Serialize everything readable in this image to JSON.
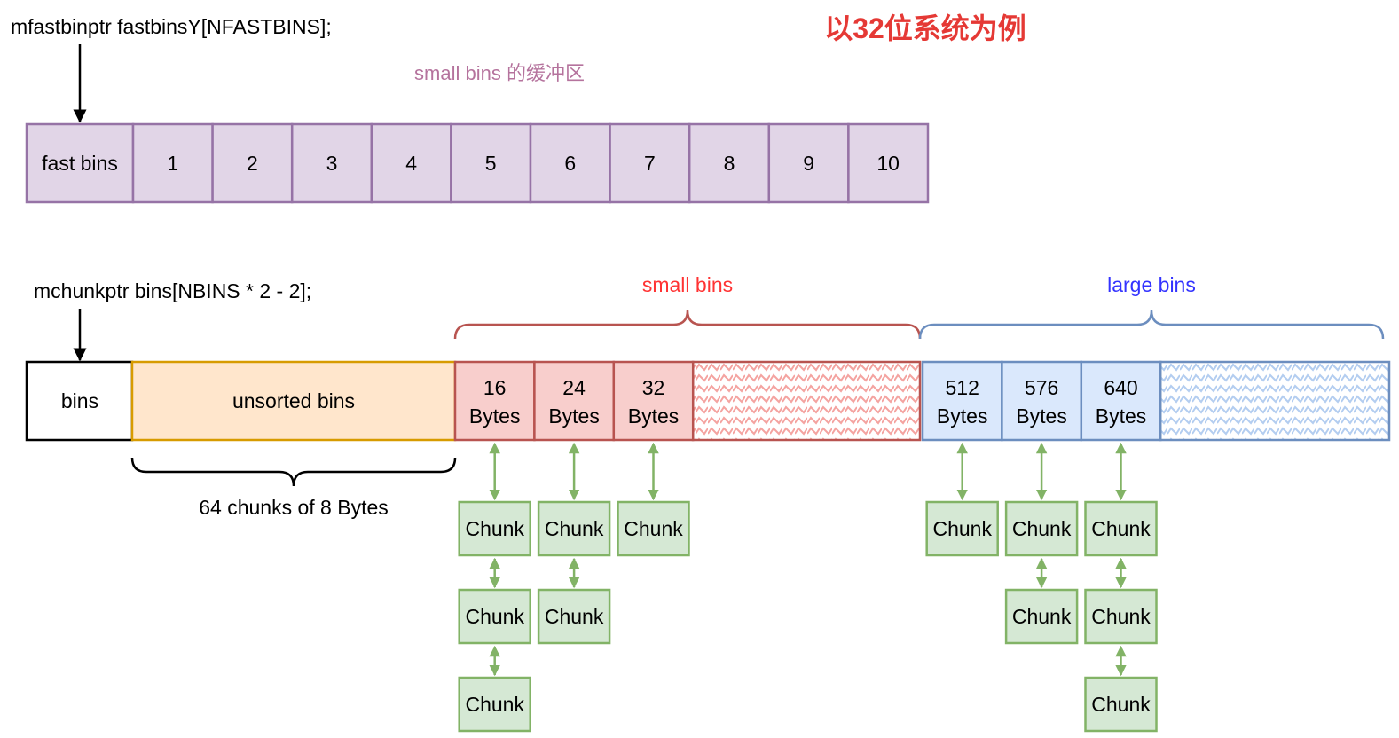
{
  "top_title": "以32位系统为例",
  "fastbins_decl": "mfastbinptr fastbinsY[NFASTBINS];",
  "fastbins_buffer_label": "small bins 的缓冲区",
  "fastbins_row": {
    "head": "fast bins",
    "cells": [
      "1",
      "2",
      "3",
      "4",
      "5",
      "6",
      "7",
      "8",
      "9",
      "10"
    ]
  },
  "bins_decl": "mchunkptr bins[NBINS * 2 - 2];",
  "small_bins_label": "small bins",
  "large_bins_label": "large bins",
  "bins_head": "bins",
  "unsorted_label": "unsorted bins",
  "unsorted_brace_label": "64 chunks of 8 Bytes",
  "small_bins": [
    {
      "size": "16",
      "unit": "Bytes",
      "chunks": [
        "Chunk",
        "Chunk",
        "Chunk"
      ]
    },
    {
      "size": "24",
      "unit": "Bytes",
      "chunks": [
        "Chunk",
        "Chunk"
      ]
    },
    {
      "size": "32",
      "unit": "Bytes",
      "chunks": [
        "Chunk"
      ]
    }
  ],
  "large_bins": [
    {
      "size": "512",
      "unit": "Bytes",
      "chunks": [
        "Chunk"
      ]
    },
    {
      "size": "576",
      "unit": "Bytes",
      "chunks": [
        "Chunk",
        "Chunk"
      ]
    },
    {
      "size": "640",
      "unit": "Bytes",
      "chunks": [
        "Chunk",
        "Chunk",
        "Chunk"
      ]
    }
  ],
  "colors": {
    "title_red": "#e53935",
    "purple_fill": "#e1d5e7",
    "purple_stroke": "#9673a6",
    "purple_text": "#b5739d",
    "orange_fill": "#ffe6cc",
    "orange_stroke": "#d79b00",
    "red_fill": "#f8cecc",
    "red_stroke": "#b85450",
    "red_label": "#ff3333",
    "blue_fill": "#dae8fc",
    "blue_stroke": "#6c8ebf",
    "blue_label": "#3333ff",
    "green_fill": "#d5e8d4",
    "green_stroke": "#82b366"
  }
}
